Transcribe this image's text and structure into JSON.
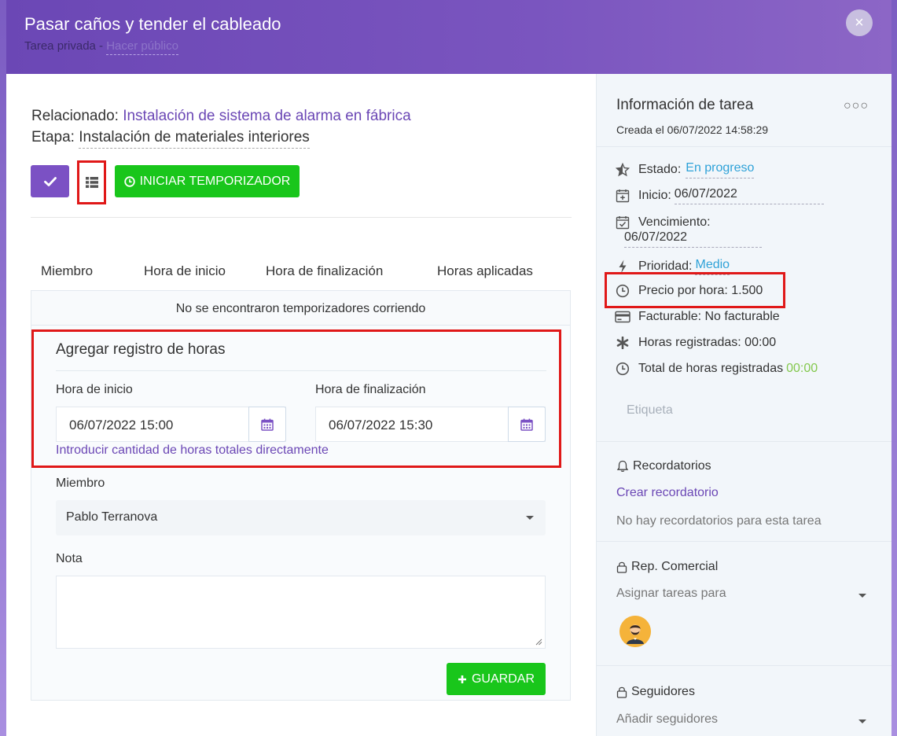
{
  "header": {
    "title": "Pasar caños y tender el cableado",
    "privacy": "Tarea privada - ",
    "make_public": "Hacer público",
    "close_label": "×"
  },
  "main": {
    "related_label": "Relacionado:",
    "related_value": "Instalación de sistema de alarma en fábrica",
    "stage_label": "Etapa:",
    "stage_value": "Instalación de materiales interiores",
    "timer_button": "INICIAR TEMPORIZADOR",
    "table_headers": [
      "Miembro",
      "Hora de inicio",
      "Hora de finalización",
      "Horas aplicadas"
    ],
    "no_timers": "No se encontraron temporizadores corriendo",
    "add_title": "Agregar registro de horas",
    "start_label": "Hora de inicio",
    "start_value": "06/07/2022 15:00",
    "end_label": "Hora de finalización",
    "end_value": "06/07/2022 15:30",
    "direct_hours_link": "Introducir cantidad de horas totales directamente",
    "member_label": "Miembro",
    "member_value": "Pablo Terranova",
    "note_label": "Nota",
    "save_button": "GUARDAR"
  },
  "sidebar": {
    "title": "Información de tarea",
    "dots": "○○○",
    "created": "Creada el 06/07/2022 14:58:29",
    "status_label": "Estado:",
    "status_value": "En progreso",
    "start_label": "Inicio:",
    "start_value": "06/07/2022",
    "due_label": "Vencimiento:",
    "due_value": "06/07/2022",
    "priority_label": "Prioridad:",
    "priority_value": "Medio",
    "price_text": "Precio por hora: 1.500",
    "billable_text": "Facturable: No facturable",
    "logged_text": "Horas registradas: 00:00",
    "total_label": "Total de horas registradas",
    "total_value": "00:00",
    "tag_placeholder": "Etiqueta",
    "reminders_title": "Recordatorios",
    "create_reminder": "Crear recordatorio",
    "no_reminders": "No hay recordatorios para esta tarea",
    "sales_title": "Rep. Comercial",
    "assign_placeholder": "Asignar tareas para",
    "followers_title": "Seguidores",
    "add_followers": "Añadir seguidores"
  },
  "colors": {
    "brand_purple": "#6b47b5",
    "success_green": "#19c61b",
    "highlight_red": "#e01818",
    "link_blue": "#2fa2d8"
  }
}
